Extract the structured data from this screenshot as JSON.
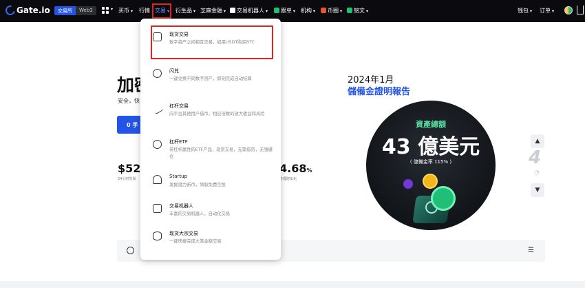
{
  "nav": {
    "logo_text": "Gate.io",
    "segment": [
      "交易所",
      "Web3"
    ],
    "items": [
      {
        "label": "买币"
      },
      {
        "label": "行情"
      },
      {
        "label": "交易"
      },
      {
        "label": "衍生品"
      },
      {
        "label": "芝麻金融"
      },
      {
        "label": "交易机器人"
      },
      {
        "label": "跟单"
      },
      {
        "label": "机构"
      },
      {
        "label": "币圈"
      },
      {
        "label": "铭文"
      }
    ],
    "right": [
      "钱包",
      "订单"
    ]
  },
  "hero": {
    "title": "加密",
    "subtitle": "安全，快",
    "cta": "0 手",
    "stat1_value": "$52.",
    "stat1_caption": "24小时交易",
    "stat2_value": "4.68",
    "stat2_unit": "%",
    "stat2_caption": "管理财年化"
  },
  "reserve": {
    "year": "2024年1月",
    "title": "儲備金證明報告",
    "label": "資產總額",
    "amount": "43 億美元",
    "ratio": "( 儲備金率 115% )",
    "slide_number": "4"
  },
  "dropdown": {
    "items": [
      {
        "name": "现货交易",
        "desc": "数字资产之间相互交易，如用USDT购买BTC",
        "icon": "spot-trade-icon"
      },
      {
        "name": "闪兑",
        "desc": "一键兑换不同数字资产，即刻完成自动结算",
        "icon": "swap-icon"
      },
      {
        "name": "杠杆交易",
        "desc": "向平台其他用户借币，相应倍数的放大收益和风险",
        "icon": "margin-icon"
      },
      {
        "name": "杠杆ETF",
        "desc": "带杠杆属性的ETF产品，现货交易，无需借贷，无强爆仓",
        "icon": "etf-icon"
      },
      {
        "name": "Startup",
        "desc": "发掘潜力新币，领取免费空投",
        "icon": "parachute-icon"
      },
      {
        "name": "交易机器人",
        "desc": "丰富的交易机器人，自动化交易",
        "icon": "robot-icon"
      },
      {
        "name": "现货大宗交易",
        "desc": "一键快捷完成大笔金额交易",
        "icon": "block-trade-icon"
      }
    ]
  },
  "colors": {
    "accent": "#2354e6",
    "highlight": "#e42222",
    "topbar": "#0b0b0f"
  }
}
